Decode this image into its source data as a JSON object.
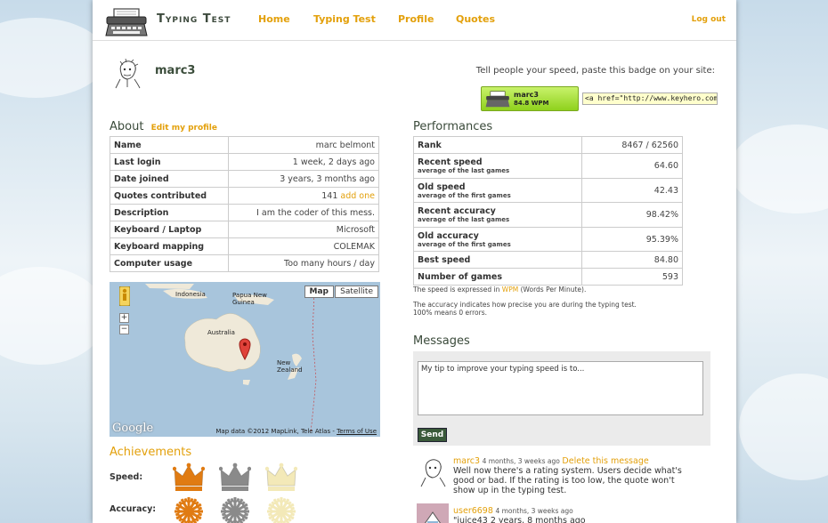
{
  "header": {
    "brand": "Typing Test",
    "nav": [
      "Home",
      "Typing Test",
      "Profile",
      "Quotes"
    ],
    "logout": "Log out"
  },
  "profile": {
    "username": "marc3",
    "badge_hint": "Tell people your speed, paste this badge on your site:",
    "badge_name": "marc3",
    "badge_wpm": "84.8 WPM",
    "badge_code": "<a href=\"http://www.keyhero.com/p"
  },
  "about": {
    "title": "About",
    "edit_link": "Edit my profile",
    "rows": [
      {
        "label": "Name",
        "value": "marc belmont"
      },
      {
        "label": "Last login",
        "value": "1 week, 2 days ago"
      },
      {
        "label": "Date joined",
        "value": "3 years, 3 months ago"
      },
      {
        "label": "Quotes contributed",
        "value": "141",
        "link": "add one"
      },
      {
        "label": "Description",
        "value": "I am the coder of this mess."
      },
      {
        "label": "Keyboard / Laptop",
        "value": "Microsoft"
      },
      {
        "label": "Keyboard mapping",
        "value": "COLEMAK"
      },
      {
        "label": "Computer usage",
        "value": "Too many hours / day"
      }
    ]
  },
  "map": {
    "btn_map": "Map",
    "btn_satellite": "Satellite",
    "labels": [
      "Indonesia",
      "Papua New Guinea",
      "Australia",
      "New Zealand"
    ],
    "zoom_in": "+",
    "zoom_out": "−",
    "footer": "Map data ©2012 MapLink, Tele Atlas -",
    "terms": "Terms of Use",
    "google": "Google"
  },
  "achievements": {
    "title": "Achievements",
    "speed_label": "Speed:",
    "accuracy_label": "Accuracy:",
    "colors": [
      "#e07b12",
      "#8a8a8a",
      "#f3e9b8"
    ]
  },
  "performances": {
    "title": "Performances",
    "rows": [
      {
        "label": "Rank",
        "sub": "",
        "value": "8467 / 62560"
      },
      {
        "label": "Recent speed",
        "sub": "average of the last games",
        "value": "64.60"
      },
      {
        "label": "Old speed",
        "sub": "average of the first games",
        "value": "42.43"
      },
      {
        "label": "Recent accuracy",
        "sub": "average of the last games",
        "value": "98.42%"
      },
      {
        "label": "Old accuracy",
        "sub": "average of the first games",
        "value": "95.39%"
      },
      {
        "label": "Best speed",
        "sub": "",
        "value": "84.80"
      },
      {
        "label": "Number of games",
        "sub": "",
        "value": "593"
      }
    ],
    "note_prefix": "The speed is expressed in",
    "note_wpm": "WPM",
    "note_suffix": "(Words Per Minute).",
    "note2": "The accuracy indicates how precise you are during the typing test.",
    "note3": "100% means 0 errors."
  },
  "messages": {
    "title": "Messages",
    "placeholder": "My tip to improve your typing speed is to...",
    "send": "Send",
    "items": [
      {
        "author": "marc3",
        "time": "4 months, 3 weeks ago",
        "delete": "Delete this message",
        "text": "Well now there's a rating system. Users decide what's good or bad. If the rating is too low, the quote won't show up in the typing test."
      },
      {
        "author": "user6698",
        "time": "4 months, 3 weeks ago",
        "delete": "",
        "text": "\"juice43 2 years, 8 months ago"
      }
    ]
  }
}
